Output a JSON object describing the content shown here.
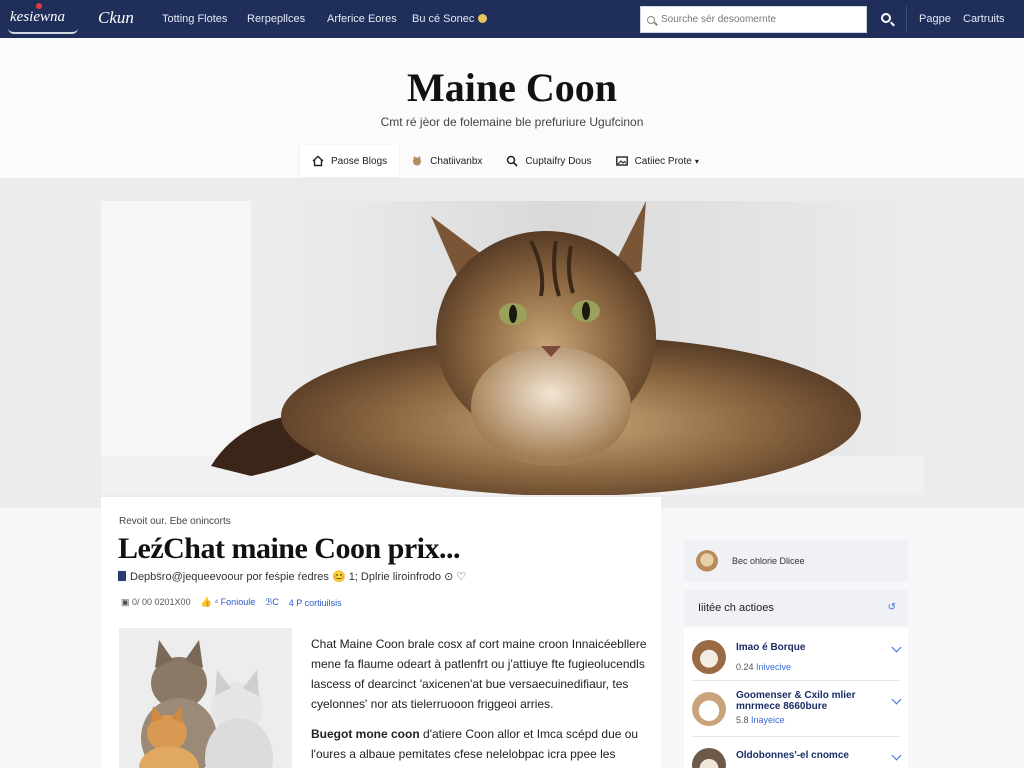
{
  "header": {
    "logo": "kesiewna",
    "logo_secondary": "Ckun",
    "nav": [
      "Totting Flotes",
      "Rerpepllces",
      "Arferice Eores",
      "Bu cé Sonec"
    ],
    "search_placeholder": "Sourche sér desoomernte",
    "right_links": [
      "Pagpe",
      "Cartruits"
    ]
  },
  "hero": {
    "title": "Maine Coon",
    "subtitle": "Cmt ré jèor de folemaine ble prefuriure Ugufcinon",
    "tabs": [
      {
        "label": "Paose Blogs",
        "icon": "home-icon"
      },
      {
        "label": "Chatiivanbx",
        "icon": "cat-icon"
      },
      {
        "label": "Cuptaifry Dous",
        "icon": "search-icon"
      },
      {
        "label": "Catiiec Prote",
        "icon": "image-icon"
      }
    ]
  },
  "article": {
    "kicker": "Revoit our. Ebe onincorts",
    "title": "LeźChat maine Coon prix...",
    "meta": "Depbs̈ro@jequeevoour por feṡpie ŕedres 😊 1; Dplrie liroinfrodo ⊙ ♡",
    "date": "0/ 00 0201X00",
    "stat_link": "⁴ Fonioule",
    "stat_tag": "ℬC",
    "comments": "4 P cortiuilsis",
    "paragraph1": "Chat Maine Coon brale cosx af cort maine croon Innaicéebllere mene fa flaume odeart à patlenfrt ou j'attiuye fte fugieolucendls lascess of dearcinct 'axicenen'at bue versaecuinedifiaur, tes cyelonnes' nor ats tielerruooon friggeoi arries.",
    "bold_lead": "Buegot mone coon",
    "paragraph2": "d'atiere Coon allor et Imca scépd due ou l'oures a albaue pemitates cfese nelelobpac icra ppee les"
  },
  "sidebar": {
    "top_label": "Bec ohlorie Dlicee",
    "section_title": "Iiitée ch actioes",
    "edit_label": "↺",
    "items": [
      {
        "title": "Imao é Borque",
        "sub": "0.24",
        "sub_link": "Inivecive"
      },
      {
        "title": "Goomenser & Cxilo mlier mnrmece 8660bure",
        "sub": "5.8",
        "sub_link": "Inayeice"
      },
      {
        "title": "Oldobonnes'-el cnomce",
        "sub": "",
        "sub_link": ""
      }
    ]
  },
  "colors": {
    "nav_bg": "#1f2f5a",
    "accent_blue": "#3a6ad8",
    "title_text": "#111111"
  }
}
